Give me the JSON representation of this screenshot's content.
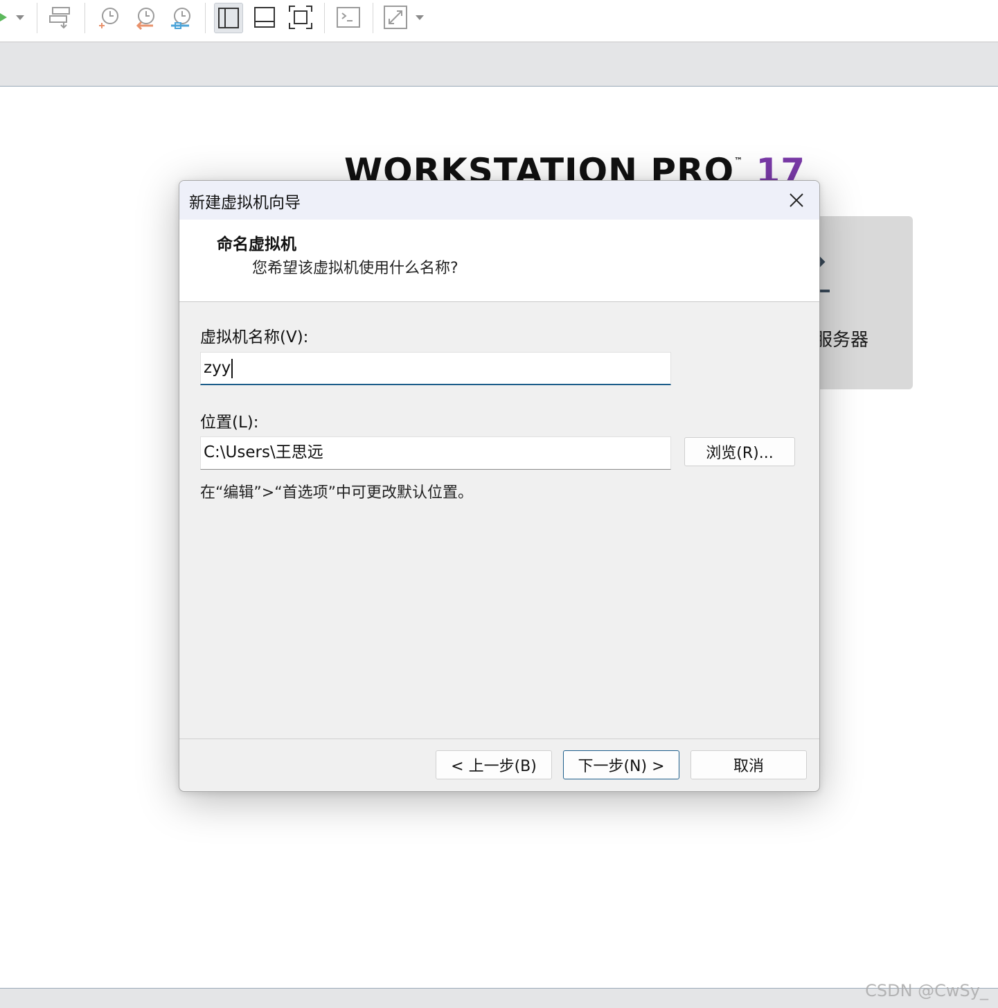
{
  "toolbar": {
    "icons": [
      "play-icon",
      "dropdown-arrow-icon",
      "network-transfer-icon",
      "snapshot-take-icon",
      "snapshot-revert-icon",
      "snapshot-manager-icon",
      "library-view-icon",
      "thumbnail-bar-icon",
      "fullscreen-icon",
      "console-icon",
      "stretch-icon",
      "dropdown-arrow-icon"
    ]
  },
  "background": {
    "brand": "WORKSTATION PRO",
    "brand_tm": "™",
    "brand_version": "17",
    "card_label": "服务器",
    "accent_color": "#7a3aa8"
  },
  "dialog": {
    "title": "新建虚拟机向导",
    "header_title": "命名虚拟机",
    "header_subtitle": "您希望该虚拟机使用什么名称?",
    "name_label": "虚拟机名称(V):",
    "name_value": "zyy",
    "location_label": "位置(L):",
    "location_value": "C:\\Users\\王思远",
    "browse_button": "浏览(R)...",
    "hint": "在“编辑”>“首选项”中可更改默认位置。",
    "back_button": "< 上一步(B)",
    "next_button": "下一步(N) >",
    "cancel_button": "取消"
  },
  "watermark": "CSDN @CwSy_"
}
